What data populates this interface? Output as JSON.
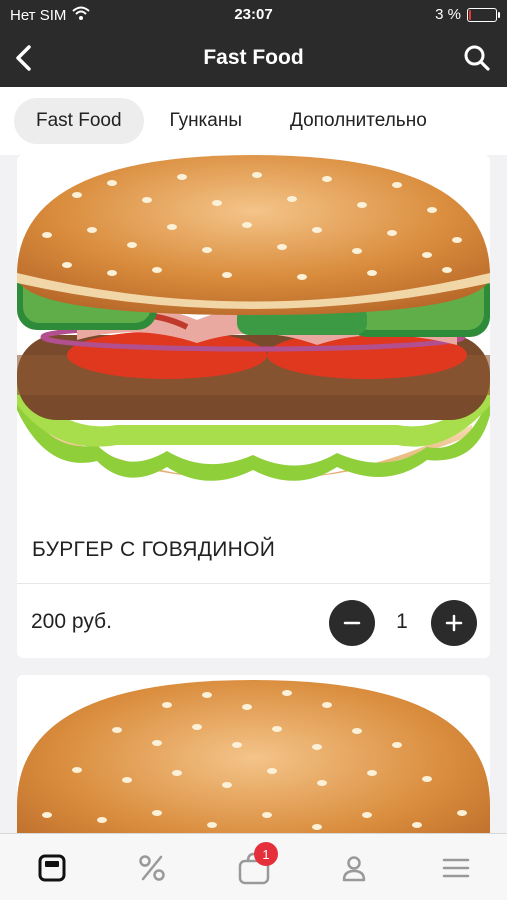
{
  "status_bar": {
    "carrier": "Нет SIM",
    "time": "23:07",
    "battery": "3 %"
  },
  "nav": {
    "title": "Fast Food",
    "back_icon": "chevron-left-icon",
    "search_icon": "search-icon"
  },
  "categories": [
    {
      "label": "Fast Food",
      "active": true
    },
    {
      "label": "Гунканы",
      "active": false
    },
    {
      "label": "Дополнительно",
      "active": false
    }
  ],
  "products": [
    {
      "title": "БУРГЕР С ГОВЯДИНОЙ",
      "price": "200 руб.",
      "quantity": "1"
    }
  ],
  "tabbar": {
    "items": [
      "menu-icon",
      "percent-icon",
      "cart-icon",
      "profile-icon",
      "hamburger-icon"
    ],
    "cart_badge": "1"
  },
  "colors": {
    "dark": "#2b2b2b",
    "badge": "#e5303c",
    "battery_low": "#e53935"
  }
}
